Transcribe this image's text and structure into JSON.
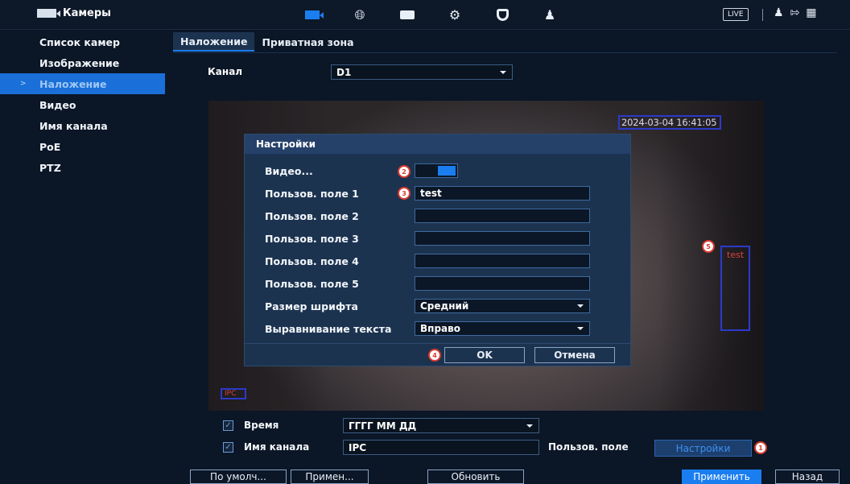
{
  "header": {
    "title": "Камеры",
    "live_label": "LIVE",
    "nav_icons": [
      "camera-icon",
      "network-globe-icon",
      "storage-icon",
      "settings-gears-icon",
      "security-shield-icon",
      "account-icon"
    ],
    "right_icons": [
      "user-icon",
      "logout-icon",
      "qr-code-icon"
    ]
  },
  "sidebar": {
    "items": [
      {
        "label": "Список камер"
      },
      {
        "label": "Изображение"
      },
      {
        "label": "Наложение"
      },
      {
        "label": "Видео"
      },
      {
        "label": "Имя канала"
      },
      {
        "label": "PoE"
      },
      {
        "label": "PTZ"
      }
    ],
    "active_index": 2
  },
  "tabs": [
    {
      "label": "Наложение"
    },
    {
      "label": "Приватная зона"
    }
  ],
  "channel": {
    "label": "Канал",
    "value": "D1"
  },
  "preview": {
    "timestamp": "2024-03-04 16:41:05",
    "custom_text": "test",
    "channel_name": "IPC"
  },
  "dialog": {
    "title": "Настройки",
    "video_label": "Видео...",
    "fields": [
      {
        "label": "Пользов. поле 1",
        "value": "test"
      },
      {
        "label": "Пользов. поле 2",
        "value": ""
      },
      {
        "label": "Пользов. поле 3",
        "value": ""
      },
      {
        "label": "Пользов. поле 4",
        "value": ""
      },
      {
        "label": "Пользов. поле 5",
        "value": ""
      }
    ],
    "font_size": {
      "label": "Размер шрифта",
      "value": "Средний"
    },
    "alignment": {
      "label": "Выравнивание текста",
      "value": "Вправо"
    },
    "ok_label": "OK",
    "cancel_label": "Отмена"
  },
  "overlay_options": {
    "time": {
      "label": "Время",
      "value": "ГГГГ ММ ДД",
      "checked": true
    },
    "channel_name": {
      "label": "Имя канала",
      "value": "IPC",
      "checked": true
    },
    "custom_label": "Пользов. поле",
    "settings_label": "Настройки"
  },
  "footer": {
    "default_label": "По умолч...",
    "copy_label": "Примен...",
    "refresh_label": "Обновить",
    "apply_label": "Применить",
    "back_label": "Назад"
  },
  "badges": [
    "1",
    "2",
    "3",
    "4",
    "5"
  ],
  "colors": {
    "accent": "#1a7ef0",
    "overlay_box": "#2b3ac9",
    "badge": "#d83a2e"
  }
}
